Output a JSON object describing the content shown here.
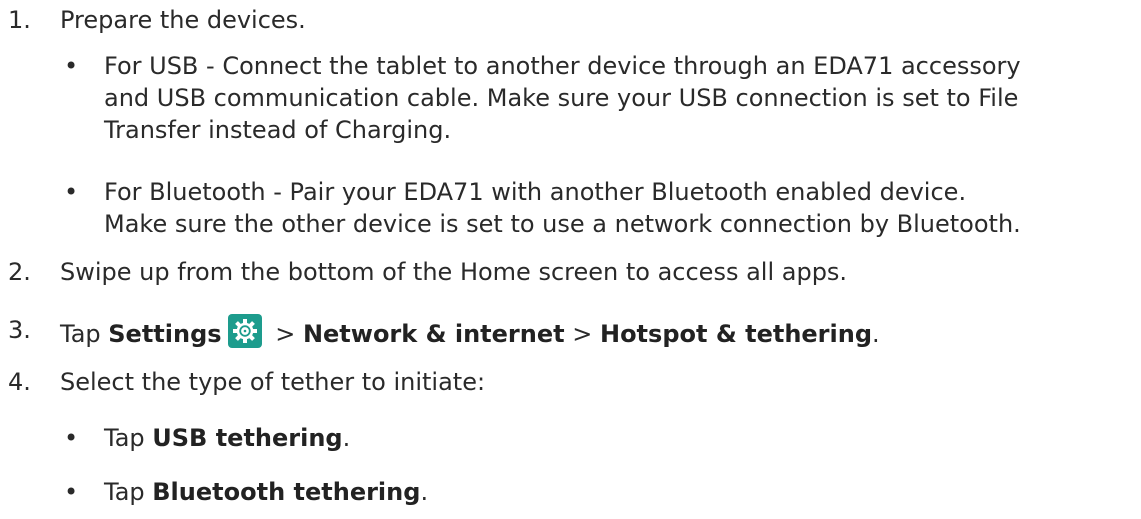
{
  "steps": [
    {
      "num": "1.",
      "text": "Prepare the devices."
    },
    {
      "num": "2.",
      "text": "Swipe up from the bottom of the Home screen to access all apps."
    },
    {
      "num": "3.",
      "tap": "Tap ",
      "settings": "Settings",
      "sep1": " > ",
      "network": "Network & internet",
      "sep2": " > ",
      "hotspot": "Hotspot & tethering",
      "end": "."
    },
    {
      "num": "4.",
      "text": "Select the type of tether to initiate:"
    }
  ],
  "step1_bullets": [
    {
      "line1": "For USB - Connect the tablet to another device through an EDA71 accessory",
      "line2": "and USB communication cable. Make sure your USB connection is set to File",
      "line3": "Transfer instead of Charging."
    },
    {
      "line1": "For Bluetooth - Pair your EDA71 with another Bluetooth enabled device.",
      "line2": "Make sure the other device is set to use a network connection by Bluetooth."
    }
  ],
  "step4_bullets": [
    {
      "tap": "Tap ",
      "bold": "USB tethering",
      "end": "."
    },
    {
      "tap": "Tap ",
      "bold": "Bluetooth tethering",
      "end": "."
    }
  ],
  "bullet_glyph": "•",
  "icons": {
    "settings": "gear-icon"
  },
  "colors": {
    "settings_icon_bg": "#1d9c8d",
    "text": "#2a2a2a"
  }
}
